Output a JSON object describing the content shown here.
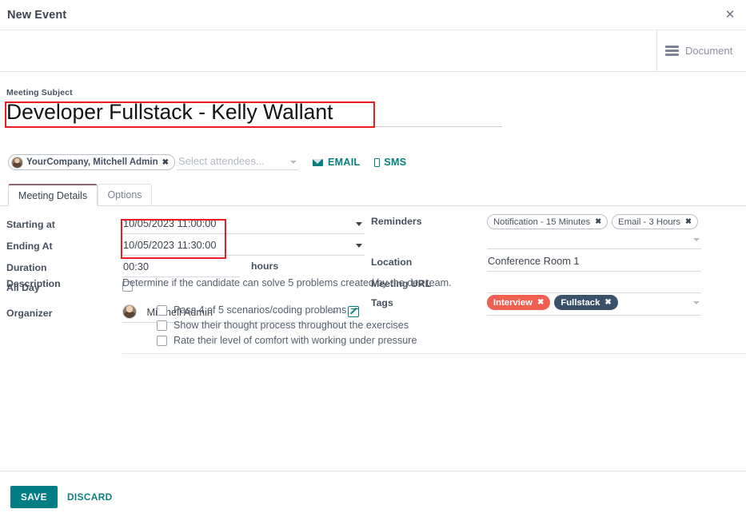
{
  "dialog": {
    "title": "New Event",
    "close_icon": "close-icon"
  },
  "buttonbar": {
    "document_label": "Document",
    "document_icon": "list-lines-icon"
  },
  "subject": {
    "label": "Meeting Subject",
    "value": "Developer Fullstack - Kelly Wallant"
  },
  "attendees": {
    "selected": [
      {
        "name": "YourCompany, Mitchell Admin",
        "remove_icon": "remove-icon"
      }
    ],
    "placeholder": "Select attendees...",
    "dropdown_icon": "chevron-down-icon",
    "email_label": "EMAIL",
    "email_icon": "envelope-icon",
    "sms_label": "SMS",
    "sms_icon": "mobile-phone-icon"
  },
  "tabs": [
    {
      "label": "Meeting Details",
      "active": true
    },
    {
      "label": "Options",
      "active": false
    }
  ],
  "fields": {
    "starting_at": {
      "label": "Starting at",
      "value": "10/05/2023 11:00:00"
    },
    "ending_at": {
      "label": "Ending At",
      "value": "10/05/2023 11:30:00"
    },
    "duration": {
      "label": "Duration",
      "value": "00:30",
      "unit": "hours"
    },
    "all_day": {
      "label": "All Day",
      "checked": false
    },
    "organizer": {
      "label": "Organizer",
      "value": "Mitchell Admin",
      "avatar": "user-avatar",
      "external_link_icon": "external-link-icon"
    },
    "reminders": {
      "label": "Reminders",
      "values": [
        "Notification - 15 Minutes",
        "Email - 3 Hours"
      ]
    },
    "location": {
      "label": "Location",
      "value": "Conference Room 1"
    },
    "meeting_url": {
      "label": "Meeting URL",
      "value": ""
    },
    "tags": {
      "label": "Tags",
      "values": [
        {
          "label": "Interview",
          "color": "#f06050"
        },
        {
          "label": "Fullstack",
          "color": "#3a5169"
        }
      ]
    }
  },
  "description": {
    "label": "Description",
    "text": "Determine if the candidate can solve 5 problems created by the dev team.",
    "items": [
      {
        "text": "Pass 4 of 5 scenarios/coding problems",
        "checked": false
      },
      {
        "text": "Show their thought process throughout the exercises",
        "checked": false
      },
      {
        "text": "Rate their level of comfort with working under pressure",
        "checked": false
      }
    ]
  },
  "footer": {
    "save_label": "SAVE",
    "discard_label": "DISCARD"
  },
  "annotations": {
    "highlight_color": "#ec1c24",
    "subject_highlight": "Developer Fullstack - Kelly Wallant",
    "dates_highlight": "10/05/2023 11:00:00 / 10/05/2023 11:30:00"
  }
}
